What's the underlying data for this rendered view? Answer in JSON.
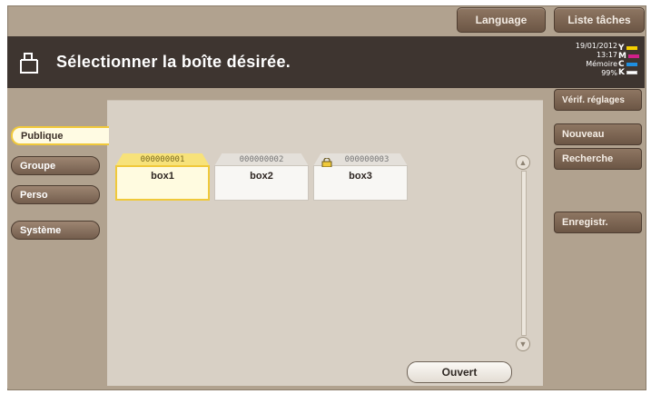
{
  "top_buttons": {
    "language": "Language",
    "task_list": "Liste tâches"
  },
  "header": {
    "title": "Sélectionner la boîte désirée.",
    "icon": "box-icon"
  },
  "status": {
    "date": "19/01/2012",
    "time": "13:17",
    "memory_label": "Mémoire",
    "memory_value": "99%",
    "toner": [
      {
        "letter": "Y",
        "color": "#f5d000"
      },
      {
        "letter": "M",
        "color": "#d0208a"
      },
      {
        "letter": "C",
        "color": "#1f8fe0"
      },
      {
        "letter": "K",
        "color": "#222222"
      }
    ]
  },
  "right_buttons": {
    "check_settings": "Vérif. réglages",
    "new": "Nouveau",
    "search": "Recherche",
    "register": "Enregistr."
  },
  "tabs": [
    {
      "label": "Publique",
      "active": true
    },
    {
      "label": "Groupe",
      "active": false
    },
    {
      "label": "Perso",
      "active": false
    },
    {
      "label": "Système",
      "active": false
    }
  ],
  "boxes": [
    {
      "number": "000000001",
      "name": "box1",
      "selected": true,
      "locked": false
    },
    {
      "number": "000000002",
      "name": "box2",
      "selected": false,
      "locked": false
    },
    {
      "number": "000000003",
      "name": "box3",
      "selected": false,
      "locked": true
    }
  ],
  "open_button": "Ouvert",
  "colors": {
    "panel": "#b1a28f",
    "header": "#3e3530",
    "accent": "#f1c93b"
  }
}
